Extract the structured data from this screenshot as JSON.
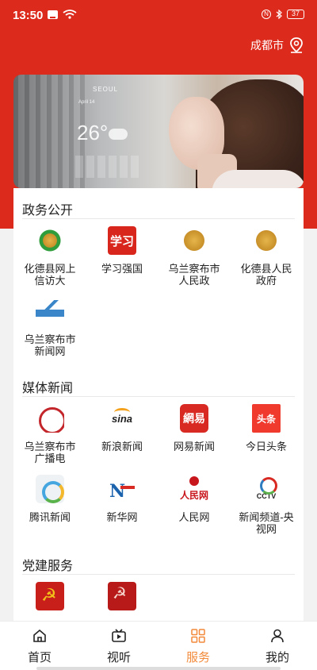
{
  "status_bar": {
    "time": "13:50",
    "battery": "37",
    "icons": [
      "message-icon",
      "wifi-icon",
      "nfc-icon",
      "bluetooth-icon",
      "battery-icon"
    ]
  },
  "header": {
    "city": "成都市",
    "location_icon": "map-pin-icon"
  },
  "banner": {
    "weather_city": "SEOUL",
    "weather_date": "April 14",
    "weather_temp": "26°"
  },
  "sections": {
    "government": {
      "title": "政务公开",
      "items": [
        {
          "label": "化德县网上信访大",
          "icon": "emblem-green-icon"
        },
        {
          "label": "学习强国",
          "icon": "xuexi-icon",
          "glyph": "学习"
        },
        {
          "label": "乌兰察布市人民政",
          "icon": "national-emblem-icon"
        },
        {
          "label": "化德县人民政府",
          "icon": "national-emblem-icon"
        },
        {
          "label": "乌兰察布市新闻网",
          "icon": "news-net-icon"
        }
      ]
    },
    "media": {
      "title": "媒体新闻",
      "items": [
        {
          "label": "乌兰察布市广播电",
          "icon": "radio-icon"
        },
        {
          "label": "新浪新闻",
          "icon": "sina-icon",
          "glyph": "sina"
        },
        {
          "label": "网易新闻",
          "icon": "netease-icon",
          "glyph": "網易"
        },
        {
          "label": "今日头条",
          "icon": "toutiao-icon",
          "glyph": "头条"
        },
        {
          "label": "腾讯新闻",
          "icon": "tencent-icon"
        },
        {
          "label": "新华网",
          "icon": "xinhua-icon"
        },
        {
          "label": "人民网",
          "icon": "people-icon",
          "glyph": "人民网"
        },
        {
          "label": "新闻频道-央视网",
          "icon": "cctv-icon",
          "glyph": "CCTV"
        }
      ]
    },
    "party": {
      "title": "党建服务",
      "items": [
        {
          "label": "",
          "icon": "party-emblem-icon"
        },
        {
          "label": "",
          "icon": "party-emblem-icon"
        }
      ]
    }
  },
  "tabbar": {
    "tabs": [
      {
        "label": "首页",
        "icon": "home-icon"
      },
      {
        "label": "视听",
        "icon": "video-icon"
      },
      {
        "label": "服务",
        "icon": "grid-icon",
        "active": true
      },
      {
        "label": "我的",
        "icon": "user-icon"
      }
    ],
    "active_color": "#f28a3a"
  },
  "colors": {
    "brand_red": "#dc2a1c"
  }
}
